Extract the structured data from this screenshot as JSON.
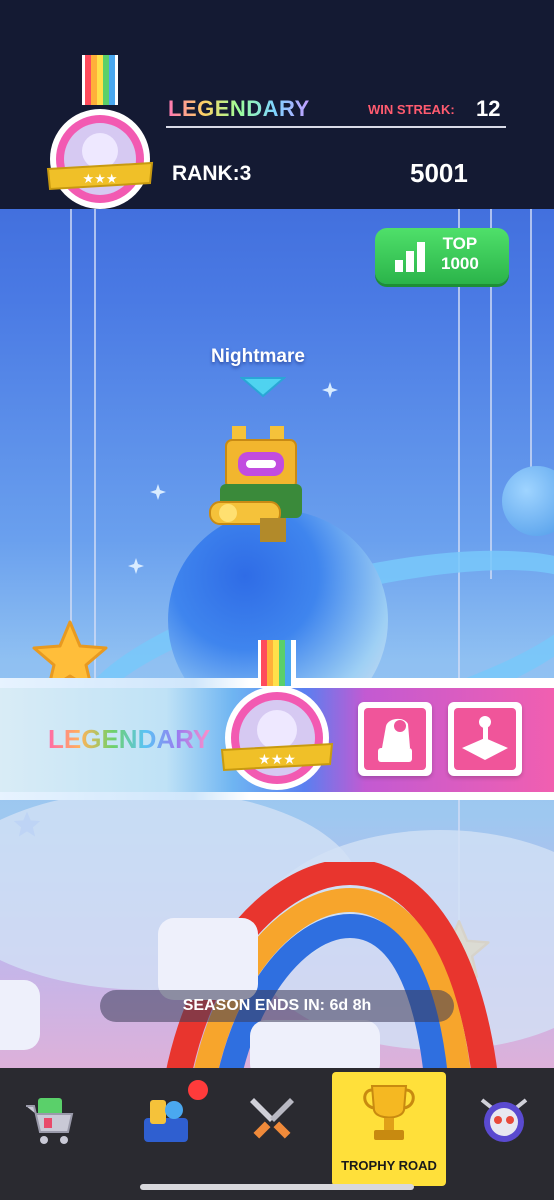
{
  "header": {
    "tier": "LEGENDARY",
    "win_streak_label": "WIN STREAK:",
    "win_streak_value": "12",
    "rank": "RANK:3",
    "score": "5001"
  },
  "leaderboard_button": {
    "line1": "TOP",
    "line2": "1000",
    "icon": "bar-chart-icon"
  },
  "player": {
    "name": "Nightmare"
  },
  "tier_banner": {
    "tier": "LEGENDARY",
    "rewards": [
      "cannon-icon",
      "joystick-icon"
    ]
  },
  "season": {
    "label": "SEASON ENDS IN:",
    "value": "6d 8h"
  },
  "nav": {
    "items": [
      {
        "icon": "shop-cart-icon"
      },
      {
        "icon": "collection-icon",
        "badge": true
      },
      {
        "icon": "battle-swords-icon"
      },
      {
        "icon": "trophy-icon",
        "label": "TROPHY ROAD",
        "active": true
      },
      {
        "icon": "skull-helmet-icon"
      }
    ]
  },
  "colors": {
    "header_bg": "#141a33",
    "accent_green": "#2bb44a",
    "streak_red": "#ff5b6f",
    "nav_active": "#ffe03a"
  }
}
